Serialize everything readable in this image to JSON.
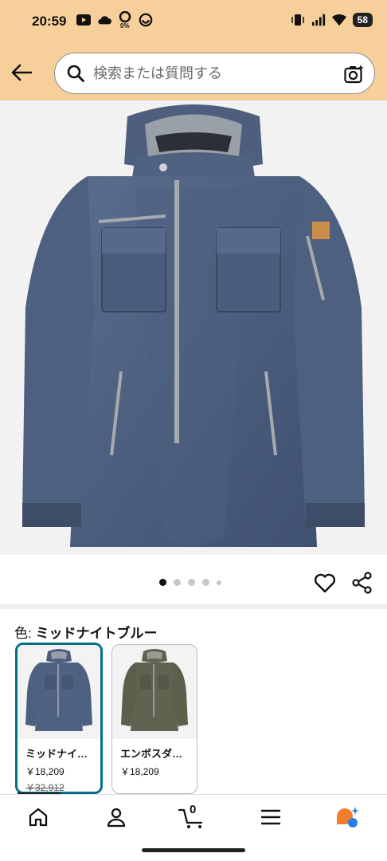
{
  "status_bar": {
    "time": "20:59",
    "left_icons": [
      "youtube-icon",
      "cloud-icon",
      "data-saver-icon",
      "app-icon"
    ],
    "right_icons": [
      "vibrate-icon",
      "signal-icon",
      "wifi-icon"
    ],
    "battery": "58",
    "data_saver_label": "0%"
  },
  "header": {
    "back_icon": "back-arrow-icon",
    "search_placeholder": "検索または質問する",
    "search_icon": "search-icon",
    "camera_icon": "camera-search-icon",
    "background_color": "#f6cf9a"
  },
  "product": {
    "image_alt": "ミッドナイトブルー jacket",
    "carousel": {
      "total_dots": 5,
      "active_index": 0
    },
    "actions": [
      "heart-icon",
      "share-icon"
    ]
  },
  "variation": {
    "label": "色:",
    "selected_value": "ミッドナイトブルー",
    "swatches": [
      {
        "name": "ミッドナイ…",
        "price": "￥18,209",
        "old_price": "￥32,912",
        "selected": true
      },
      {
        "name": "エンボスダ…",
        "price": "￥18,209",
        "old_price": "",
        "selected": false
      }
    ],
    "selected_border_color": "#007185"
  },
  "bottom_nav": {
    "items": [
      "home-icon",
      "account-icon",
      "cart-icon",
      "menu-icon",
      "rufus-icon"
    ],
    "cart_count": "0"
  }
}
